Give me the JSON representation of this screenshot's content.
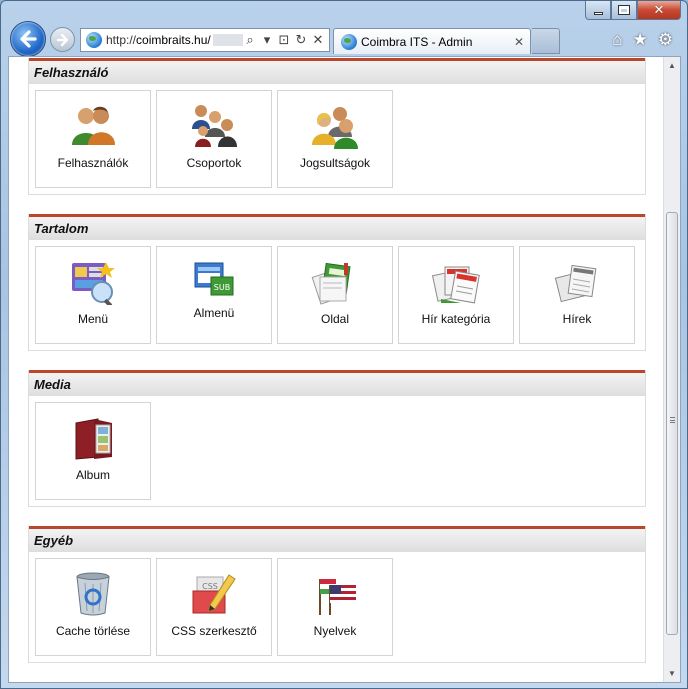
{
  "browser": {
    "url_prefix": "http://",
    "url_host": "coimbraits.hu/",
    "tab_title": "Coimbra ITS - Admin",
    "tab_close": "✕",
    "addr_icons": [
      "⌕",
      "▾",
      "⊡",
      "↻",
      "✕"
    ],
    "right_icons": [
      "⌂",
      "★",
      "⚙"
    ],
    "caption": {
      "close": "✕"
    }
  },
  "sections": [
    {
      "title": "Felhasználó",
      "tiles": [
        {
          "label": "Felhasználók",
          "icon": "users-icon"
        },
        {
          "label": "Csoportok",
          "icon": "groups-icon"
        },
        {
          "label": "Jogsultságok",
          "icon": "permissions-icon"
        }
      ]
    },
    {
      "title": "Tartalom",
      "tiles": [
        {
          "label": "Menü",
          "icon": "menu-icon"
        },
        {
          "label": "Almenü",
          "icon": "submenu-icon"
        },
        {
          "label": "Oldal",
          "icon": "page-icon"
        },
        {
          "label": "Hír kategória",
          "icon": "news-category-icon"
        },
        {
          "label": "Hírek",
          "icon": "news-icon"
        }
      ]
    },
    {
      "title": "Media",
      "tiles": [
        {
          "label": "Album",
          "icon": "album-icon"
        }
      ]
    },
    {
      "title": "Egyéb",
      "tiles": [
        {
          "label": "Cache törlése",
          "icon": "recycle-bin-icon"
        },
        {
          "label": "CSS szerkesztő",
          "icon": "css-edit-icon"
        },
        {
          "label": "Nyelvek",
          "icon": "flags-icon"
        }
      ]
    }
  ],
  "colors": {
    "section_accent": "#b9482b",
    "frame": "#a9c4e2"
  }
}
